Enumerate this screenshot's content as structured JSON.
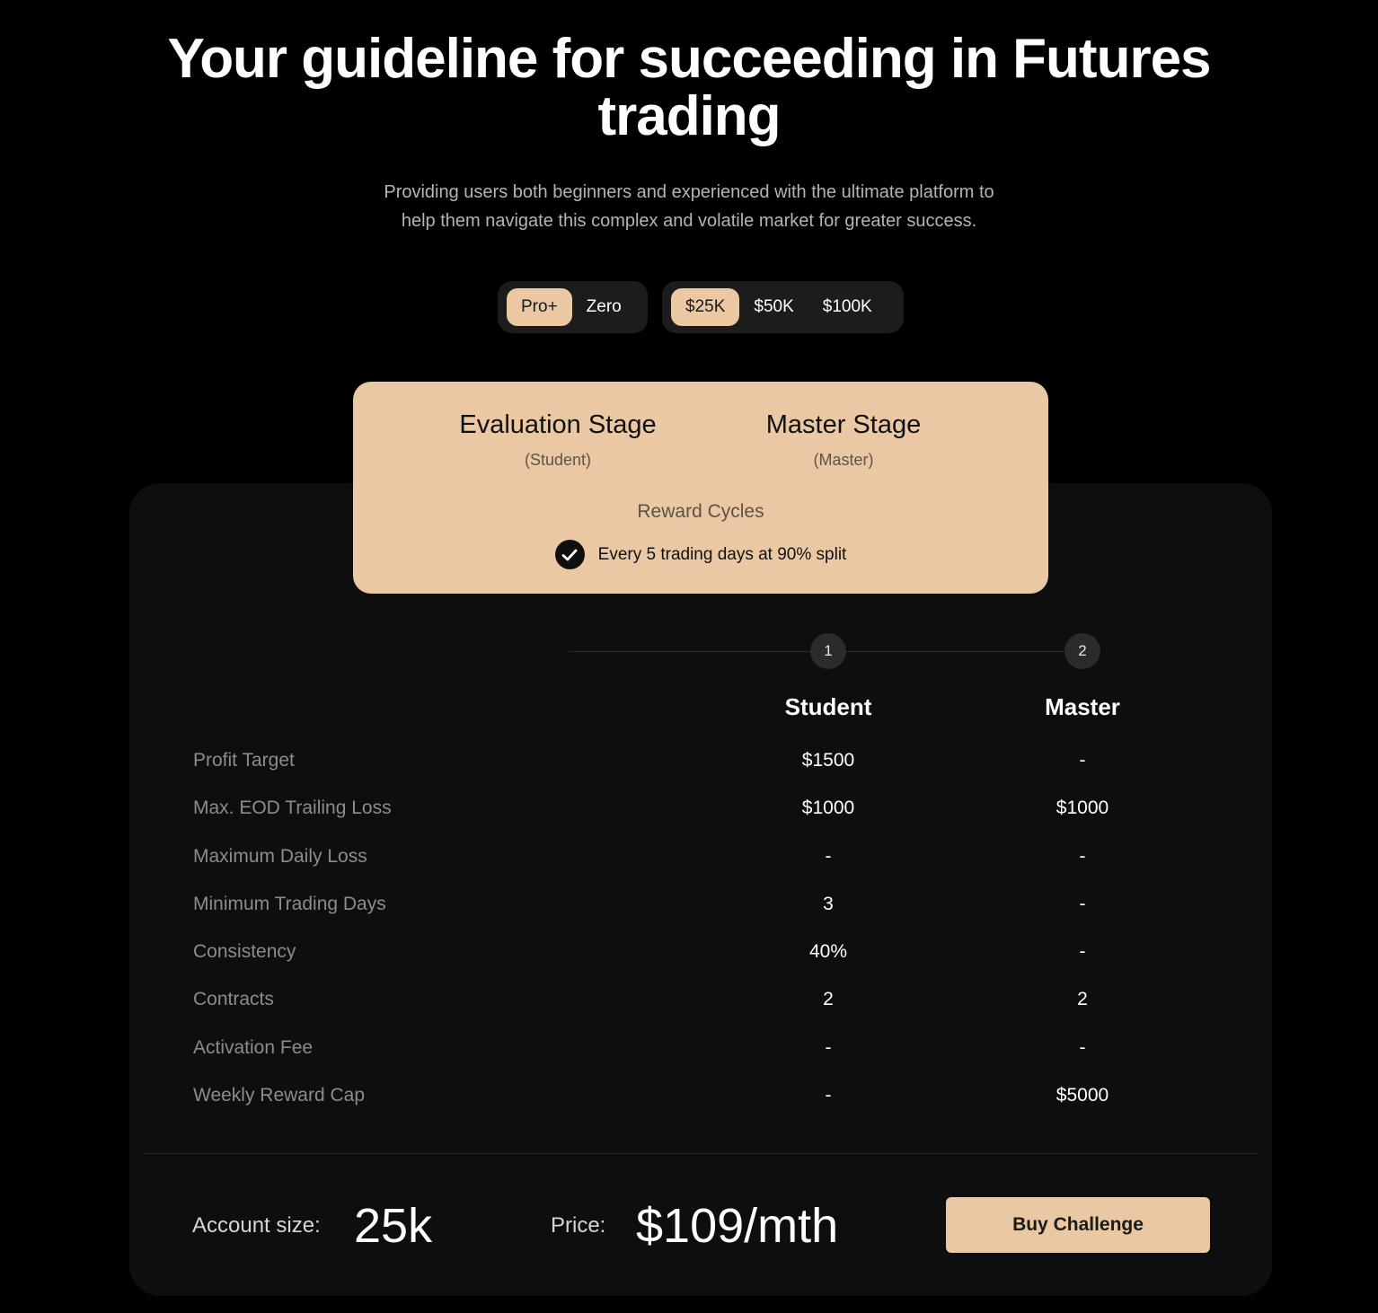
{
  "hero": {
    "title_line1": "Your guideline for succeeding in Futures",
    "title_line2": "trading",
    "subtitle_line1": "Providing users both beginners and experienced with the ultimate platform to",
    "subtitle_line2": "help them navigate this complex and volatile market for greater success."
  },
  "plan_toggle": {
    "options": [
      "Pro+",
      "Zero"
    ],
    "selected": "Pro+"
  },
  "size_toggle": {
    "options": [
      "$25K",
      "$50K",
      "$100K"
    ],
    "selected": "$25K"
  },
  "stage_card": {
    "stages": [
      {
        "name": "Evaluation Stage",
        "sub": "(Student)"
      },
      {
        "name": "Master Stage",
        "sub": "(Master)"
      }
    ],
    "reward_title": "Reward Cycles",
    "reward_text": "Every 5 trading days at 90% split",
    "reward_icon": "check-circle-icon"
  },
  "steps": [
    "1",
    "2"
  ],
  "columns": [
    "Student",
    "Master"
  ],
  "rows": [
    {
      "label": "Profit Target",
      "student": "$1500",
      "master": "-"
    },
    {
      "label": "Max. EOD Trailing Loss",
      "student": "$1000",
      "master": "$1000"
    },
    {
      "label": "Maximum Daily Loss",
      "student": "-",
      "master": "-"
    },
    {
      "label": "Minimum Trading Days",
      "student": "3",
      "master": "-"
    },
    {
      "label": "Consistency",
      "student": "40%",
      "master": "-"
    },
    {
      "label": "Contracts",
      "student": "2",
      "master": "2"
    },
    {
      "label": "Activation Fee",
      "student": "-",
      "master": "-"
    },
    {
      "label": "Weekly Reward Cap",
      "student": "-",
      "master": "$5000"
    }
  ],
  "footer": {
    "account_label": "Account size:",
    "account_value": "25k",
    "price_label": "Price:",
    "price_value": "$109/mth",
    "buy_label": "Buy Challenge"
  },
  "colors": {
    "background": "#000000",
    "panel": "#0e0e0e",
    "accent": "#eac8a3",
    "muted_text": "#8c8c8c"
  }
}
